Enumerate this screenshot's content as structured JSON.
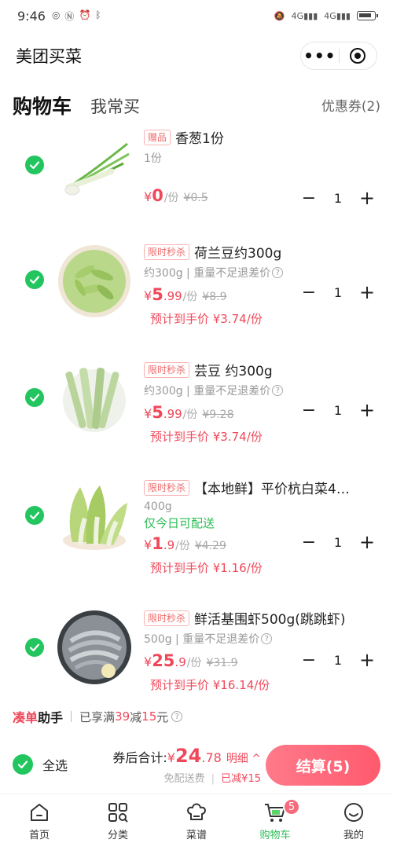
{
  "status": {
    "time": "9:46",
    "left_icons": [
      "notification-icon",
      "n-icon",
      "alarm-icon",
      "bluetooth-icon"
    ],
    "right_text_1": "4G",
    "right_text_2": "4G"
  },
  "app": {
    "title": "美团买菜"
  },
  "tabs": {
    "active": "购物车",
    "other": "我常买",
    "coupon": "优惠券(2)"
  },
  "items": [
    {
      "tag": "赠品",
      "name": "香葱1份",
      "spec": "1份",
      "price_int": "0",
      "price_dec": "",
      "unit": "/份",
      "orig": "¥0.5",
      "qty": "1",
      "est": "",
      "same_day": "",
      "has_help": false
    },
    {
      "tag": "限时秒杀",
      "name": "荷兰豆约300g",
      "spec": "约300g | 重量不足退差价",
      "price_int": "5",
      "price_dec": ".99",
      "unit": "/份",
      "orig": "¥8.9",
      "qty": "1",
      "est": "预计到手价 ¥3.74/份",
      "same_day": "",
      "has_help": true
    },
    {
      "tag": "限时秒杀",
      "name": "芸豆 约300g",
      "spec": "约300g | 重量不足退差价",
      "price_int": "5",
      "price_dec": ".99",
      "unit": "/份",
      "orig": "¥9.28",
      "qty": "1",
      "est": "预计到手价 ¥3.74/份",
      "same_day": "",
      "has_help": true
    },
    {
      "tag": "限时秒杀",
      "name": "【本地鲜】平价杭白菜4…",
      "spec": "400g",
      "price_int": "1",
      "price_dec": ".9",
      "unit": "/份",
      "orig": "¥4.29",
      "qty": "1",
      "est": "预计到手价 ¥1.16/份",
      "same_day": "仅今日可配送",
      "has_help": false
    },
    {
      "tag": "限时秒杀",
      "name": "鲜活基围虾500g(跳跳虾)",
      "spec": "500g | 重量不足退差价",
      "price_int": "25",
      "price_dec": ".9",
      "unit": "/份",
      "orig": "¥31.9",
      "qty": "1",
      "est": "预计到手价 ¥16.14/份",
      "same_day": "",
      "has_help": true
    }
  ],
  "helper": {
    "title_red": "凑单",
    "title_dark": "助手",
    "text_a": "已享满",
    "threshold": "39",
    "text_b": "减",
    "discount": "15",
    "text_c": "元"
  },
  "checkout": {
    "select_all": "全选",
    "total_label": "券后合计:",
    "yen": "¥",
    "total_int": "24",
    "total_dec": ".78",
    "detail": "明细 ^",
    "free_ship": "免配送费",
    "saved": "已减¥15",
    "pay_button": "结算(5)"
  },
  "tabbar": [
    {
      "label": "首页",
      "icon": "home-icon"
    },
    {
      "label": "分类",
      "icon": "category-icon"
    },
    {
      "label": "菜谱",
      "icon": "chef-hat-icon"
    },
    {
      "label": "购物车",
      "icon": "cart-icon",
      "badge": "5"
    },
    {
      "label": "我的",
      "icon": "profile-icon"
    }
  ],
  "colors": {
    "accent_green": "#22c55e",
    "price_red": "#f0485a",
    "pay_button": "#ff5a6e"
  }
}
